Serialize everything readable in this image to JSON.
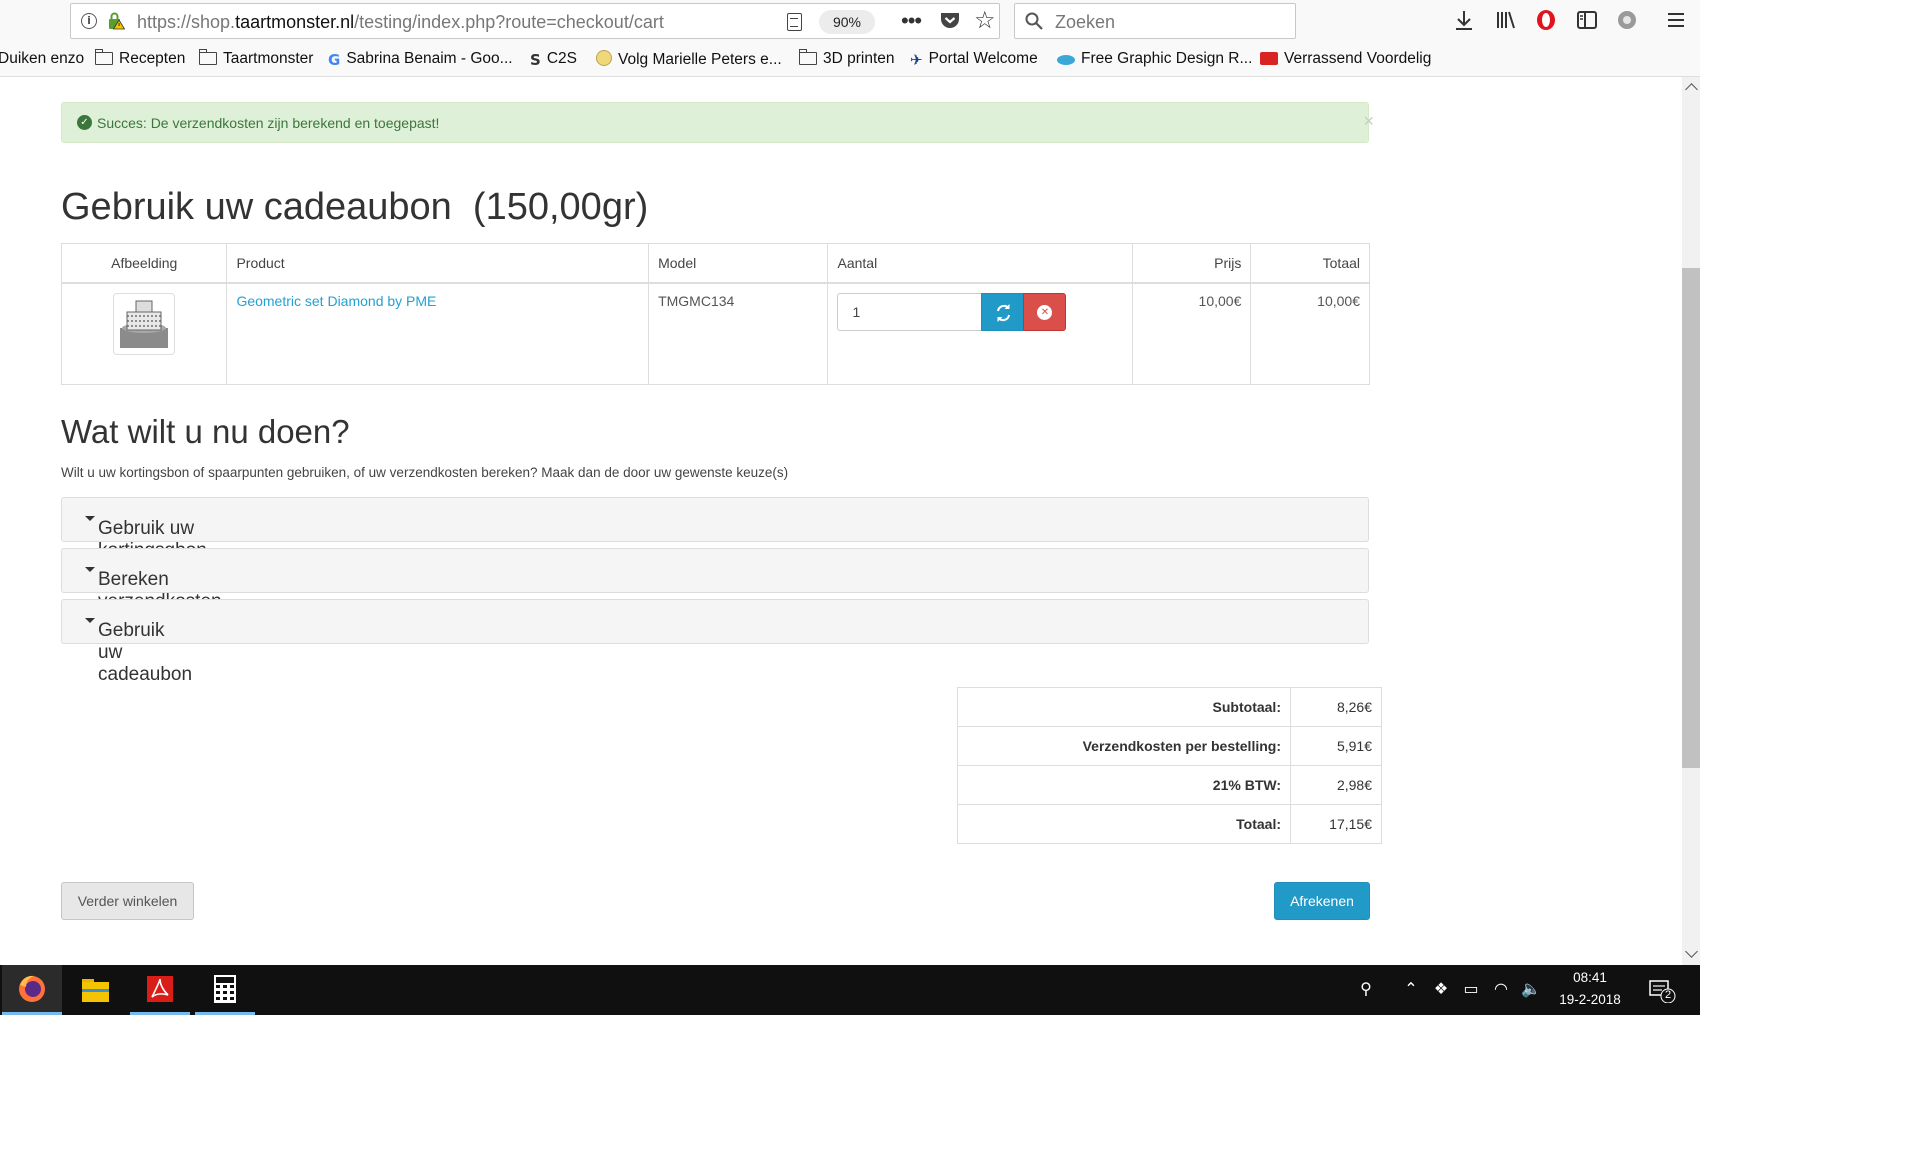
{
  "browser": {
    "url_prefix": "https://shop.",
    "url_domain": "taartmonster.nl",
    "url_path": "/testing/index.php?route=checkout/cart",
    "zoom": "90%",
    "search_placeholder": "Zoeken"
  },
  "bookmarks": [
    {
      "label": "Duiken enzo",
      "icon": "folder-icon"
    },
    {
      "label": "Recepten",
      "icon": "folder-icon"
    },
    {
      "label": "Taartmonster",
      "icon": "folder-icon"
    },
    {
      "label": "Sabrina Benaim - Goo...",
      "icon": "google-icon"
    },
    {
      "label": "C2S",
      "icon": "c2s-icon"
    },
    {
      "label": "Volg Marielle Peters e...",
      "icon": "bulb-icon"
    },
    {
      "label": "3D printen",
      "icon": "folder-icon"
    },
    {
      "label": "Portal Welcome",
      "icon": "portal-icon"
    },
    {
      "label": "Free Graphic Design R...",
      "icon": "eye-icon"
    },
    {
      "label": "Verrassend Voordelig",
      "icon": "ticket-icon"
    }
  ],
  "alert": {
    "text": "Succes: De verzendkosten zijn berekend en toegepast!",
    "close": "×"
  },
  "cart": {
    "title": "Gebruik uw cadeaubon  (150,00gr)",
    "headers": {
      "image": "Afbeelding",
      "product": "Product",
      "model": "Model",
      "quantity": "Aantal",
      "price": "Prijs",
      "total": "Totaal"
    },
    "rows": [
      {
        "product": "Geometric set Diamond by PME",
        "model": "TMGMC134",
        "quantity": "1",
        "price": "10,00€",
        "total": "10,00€"
      }
    ]
  },
  "next": {
    "title": "Wat wilt u nu doen?",
    "intro": "Wilt u uw kortingsbon of spaarpunten gebruiken, of uw verzendkosten bereken? Maak dan de door uw gewenste keuze(s)",
    "panels": [
      "Gebruik uw kortingsgbon",
      "Bereken verzendkosten & BTW",
      "Gebruik uw cadeaubon"
    ]
  },
  "totals": [
    {
      "label": "Subtotaal:",
      "value": "8,26€"
    },
    {
      "label": "Verzendkosten per bestelling:",
      "value": "5,91€"
    },
    {
      "label": "21% BTW:",
      "value": "2,98€"
    },
    {
      "label": "Totaal:",
      "value": "17,15€"
    }
  ],
  "buttons": {
    "continue": "Verder winkelen",
    "checkout": "Afrekenen"
  },
  "taskbar": {
    "time": "08:41",
    "date": "19-2-2018",
    "notification_count": "2",
    "apps": [
      "firefox-icon",
      "file-explorer-icon",
      "acrobat-icon",
      "calculator-icon"
    ]
  },
  "colors": {
    "accent": "#229ac8",
    "danger": "#da4f49",
    "success_bg": "#dff0d8",
    "success_text": "#3c763d"
  }
}
